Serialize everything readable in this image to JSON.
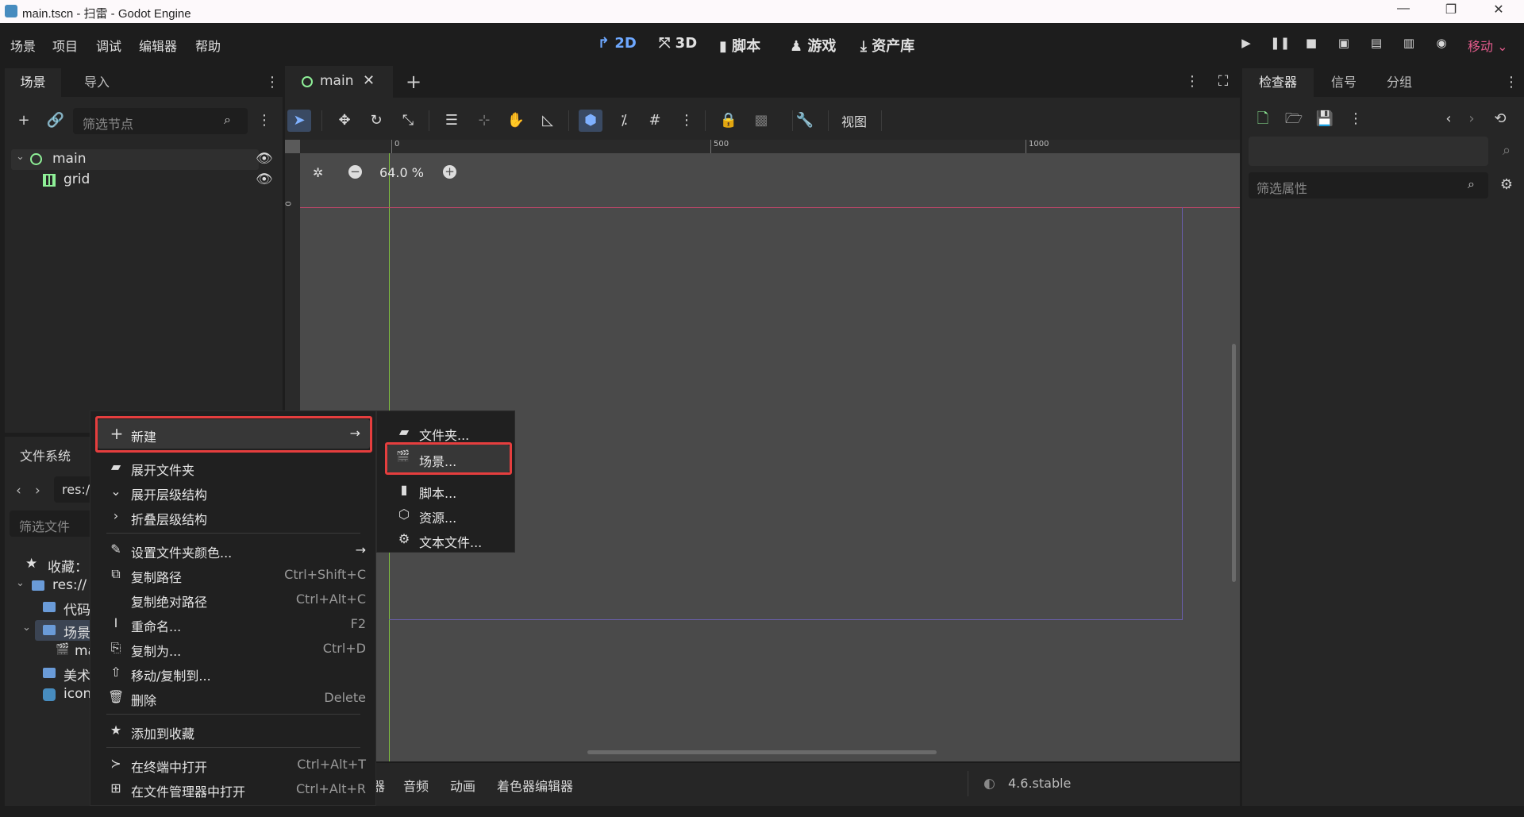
{
  "window": {
    "title": "main.tscn - 扫雷 - Godot Engine",
    "controls": [
      "—",
      "❐",
      "✕"
    ]
  },
  "menubar": {
    "items": [
      "场景",
      "项目",
      "调试",
      "编辑器",
      "帮助"
    ],
    "workspaces": [
      "2D",
      "3D",
      "脚本",
      "游戏",
      "资产库"
    ],
    "active_workspace": "2D",
    "renderer": "移动"
  },
  "scene_dock": {
    "tabs": [
      "场景",
      "导入"
    ],
    "filter_placeholder": "筛选节点",
    "nodes": [
      "main",
      "grid"
    ]
  },
  "filesystem_dock": {
    "title": "文件系统",
    "path": "res:/",
    "filter_placeholder": "筛选文件",
    "tree": [
      "收藏：",
      "res://",
      "代码",
      "场景",
      "ma",
      "美术",
      "icon."
    ]
  },
  "editor": {
    "tab": "main",
    "zoom": "64.0 %",
    "ruler": [
      "0",
      "500",
      "1000"
    ],
    "ruler_v": "0",
    "view_menu": "视图",
    "bottom_tabs": [
      "器",
      "音频",
      "动画",
      "着色器编辑器"
    ],
    "version": "4.6.stable"
  },
  "inspector": {
    "tabs": [
      "检查器",
      "信号",
      "分组"
    ],
    "filter_placeholder": "筛选属性"
  },
  "context_menu": {
    "items": [
      {
        "icon": "+",
        "label": "新建",
        "shortcut": "",
        "arrow": true
      },
      {
        "icon": "▰",
        "label": "展开文件夹",
        "shortcut": ""
      },
      {
        "icon": "⌄",
        "label": "展开层级结构",
        "shortcut": ""
      },
      {
        "icon": "›",
        "label": "折叠层级结构",
        "shortcut": ""
      },
      {
        "icon": "✎",
        "label": "设置文件夹颜色...",
        "shortcut": "",
        "arrow": true
      },
      {
        "icon": "⧉",
        "label": "复制路径",
        "shortcut": "Ctrl+Shift+C"
      },
      {
        "icon": "",
        "label": "复制绝对路径",
        "shortcut": "Ctrl+Alt+C"
      },
      {
        "icon": "I",
        "label": "重命名...",
        "shortcut": "F2"
      },
      {
        "icon": "⎘",
        "label": "复制为...",
        "shortcut": "Ctrl+D"
      },
      {
        "icon": "⇧",
        "label": "移动/复制到...",
        "shortcut": ""
      },
      {
        "icon": "🗑",
        "label": "删除",
        "shortcut": "Delete"
      },
      {
        "icon": "★",
        "label": "添加到收藏",
        "shortcut": ""
      },
      {
        "icon": "≻",
        "label": "在终端中打开",
        "shortcut": "Ctrl+Alt+T"
      },
      {
        "icon": "⊞",
        "label": "在文件管理器中打开",
        "shortcut": "Ctrl+Alt+R"
      }
    ]
  },
  "submenu": {
    "items": [
      {
        "icon": "▰",
        "label": "文件夹..."
      },
      {
        "icon": "🎬",
        "label": "场景..."
      },
      {
        "icon": "▮",
        "label": "脚本..."
      },
      {
        "icon": "⬡",
        "label": "资源..."
      },
      {
        "icon": "⚙",
        "label": "文本文件..."
      }
    ]
  },
  "colors": {
    "accent_blue": "#6ea8ff",
    "highlight_red": "#e53e3e",
    "node_green": "#8eef97",
    "renderer_pink": "#e05a8a",
    "folder_blue": "#6a9bd8"
  }
}
